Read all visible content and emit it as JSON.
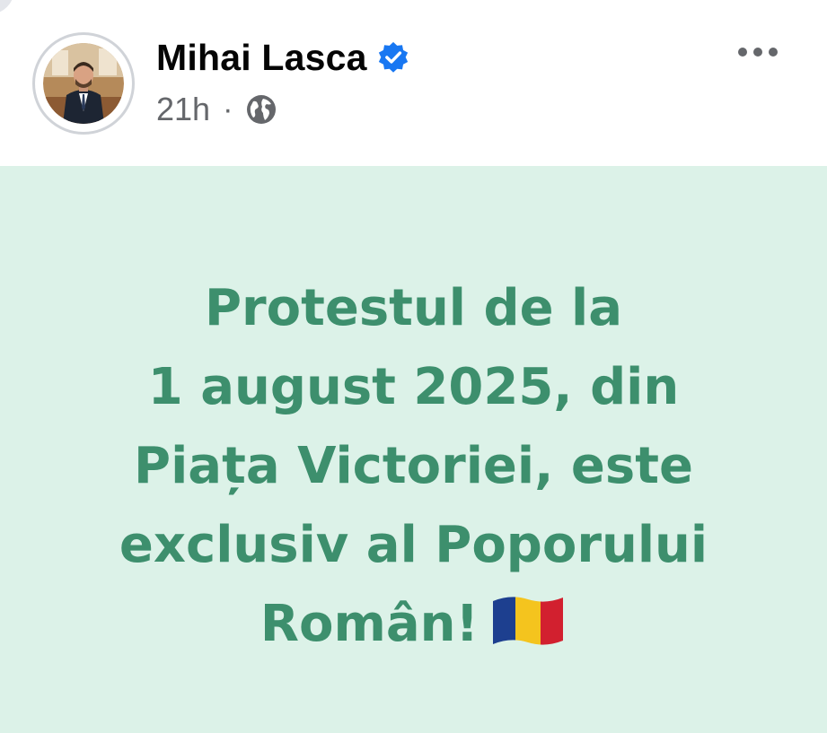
{
  "post": {
    "author": {
      "name": "Mihai Lasca",
      "verified": true,
      "avatar_icon": "profile-photo"
    },
    "time": "21h",
    "separator": "·",
    "audience_icon": "globe-icon",
    "more_icon": "more-dots-icon",
    "content": {
      "lines": [
        "Protestul de la",
        "1 august 2025, din",
        "Piața Victoriei, este",
        "exclusiv al Poporului",
        "Român!"
      ],
      "emoji": "romania-flag",
      "background_color": "#dcf2e8",
      "text_color": "#3d8f6d"
    },
    "colors": {
      "verified_badge": "#1877f2",
      "secondary_text": "#65676b"
    }
  }
}
